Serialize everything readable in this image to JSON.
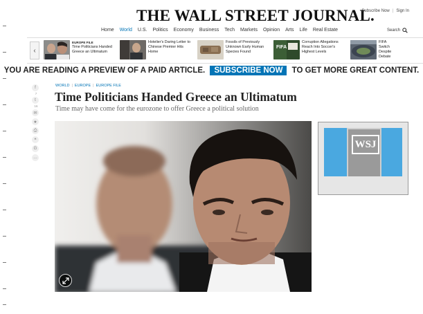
{
  "masthead": {
    "logo": "THE WALL STREET JOURNAL.",
    "subscribe_now": "Subscribe Now",
    "sign_in": "Sign In"
  },
  "nav": {
    "items": [
      "Home",
      "World",
      "U.S.",
      "Politics",
      "Economy",
      "Business",
      "Tech",
      "Markets",
      "Opinion",
      "Arts",
      "Life",
      "Real Estate"
    ],
    "active": "World",
    "search_label": "Search"
  },
  "carousel": {
    "items": [
      {
        "category": "EUROPE FILE",
        "title": "Time Politicians Handed Greece an Ultimatum"
      },
      {
        "category": "",
        "title": "Hotelier's Daring Letter to Chinese Premier Hits Home"
      },
      {
        "category": "",
        "title": "Fossils of Previously Unknown Early Human Species Found"
      },
      {
        "category": "",
        "title": "Corruption Allegations Reach Into Soccer's Highest Levels"
      },
      {
        "category": "",
        "title": "FIFA Switch Despite Debate"
      }
    ]
  },
  "banner": {
    "lead": "YOU ARE READING A PREVIEW OF A PAID ARTICLE.",
    "subscribe": "SUBSCRIBE NOW",
    "trail": "TO GET MORE GREAT CONTENT."
  },
  "share": {
    "facebook_count": "7",
    "twitter_count": "16"
  },
  "article": {
    "breadcrumb": [
      "WORLD",
      "EUROPE",
      "EUROPE FILE"
    ],
    "headline": "Time Politicians Handed Greece an Ultimatum",
    "dek": "Time may have come for the eurozone to offer Greece a political solution"
  },
  "ad": {
    "brand": "WSJ"
  },
  "colors": {
    "accent": "#0274b6",
    "ad_blue": "#4aa8e0"
  }
}
